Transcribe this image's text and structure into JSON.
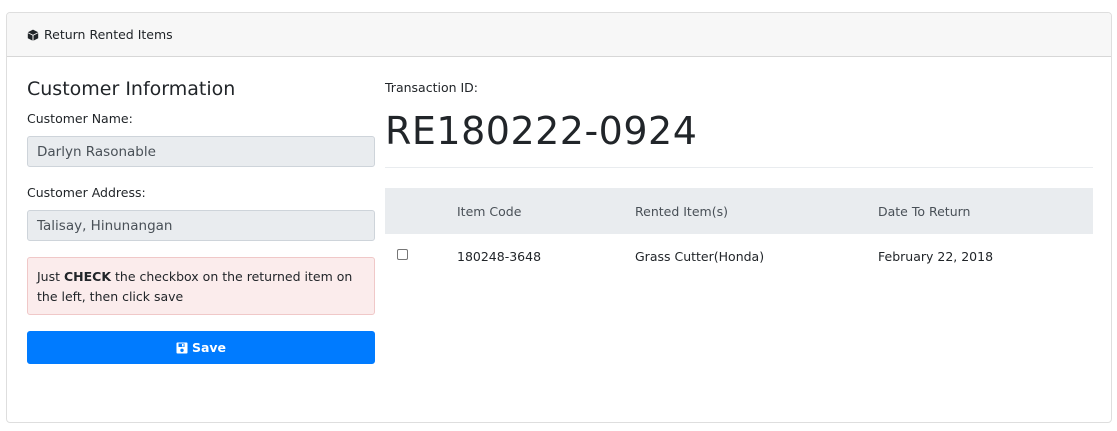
{
  "card": {
    "header_title": "Return Rented Items",
    "header_icon": "cube-icon"
  },
  "customer": {
    "heading": "Customer Information",
    "name_label": "Customer Name:",
    "name_value": "Darlyn Rasonable",
    "address_label": "Customer Address:",
    "address_value": "Talisay, Hinunangan"
  },
  "instruction": {
    "prefix": "Just ",
    "emphasis": "CHECK",
    "suffix": " the checkbox on the returned item on the left, then click save"
  },
  "save_button": {
    "label": "Save",
    "icon": "floppy-disk-icon",
    "color": "#007bff"
  },
  "transaction": {
    "label": "Transaction ID:",
    "id": "RE180222-0924"
  },
  "items_table": {
    "headers": [
      "",
      "Item Code",
      "Rented Item(s)",
      "Date To Return"
    ],
    "rows": [
      {
        "checked": false,
        "item_code": "180248-3648",
        "rented_item": "Grass Cutter(Honda)",
        "date_to_return": "February 22, 2018"
      }
    ]
  }
}
